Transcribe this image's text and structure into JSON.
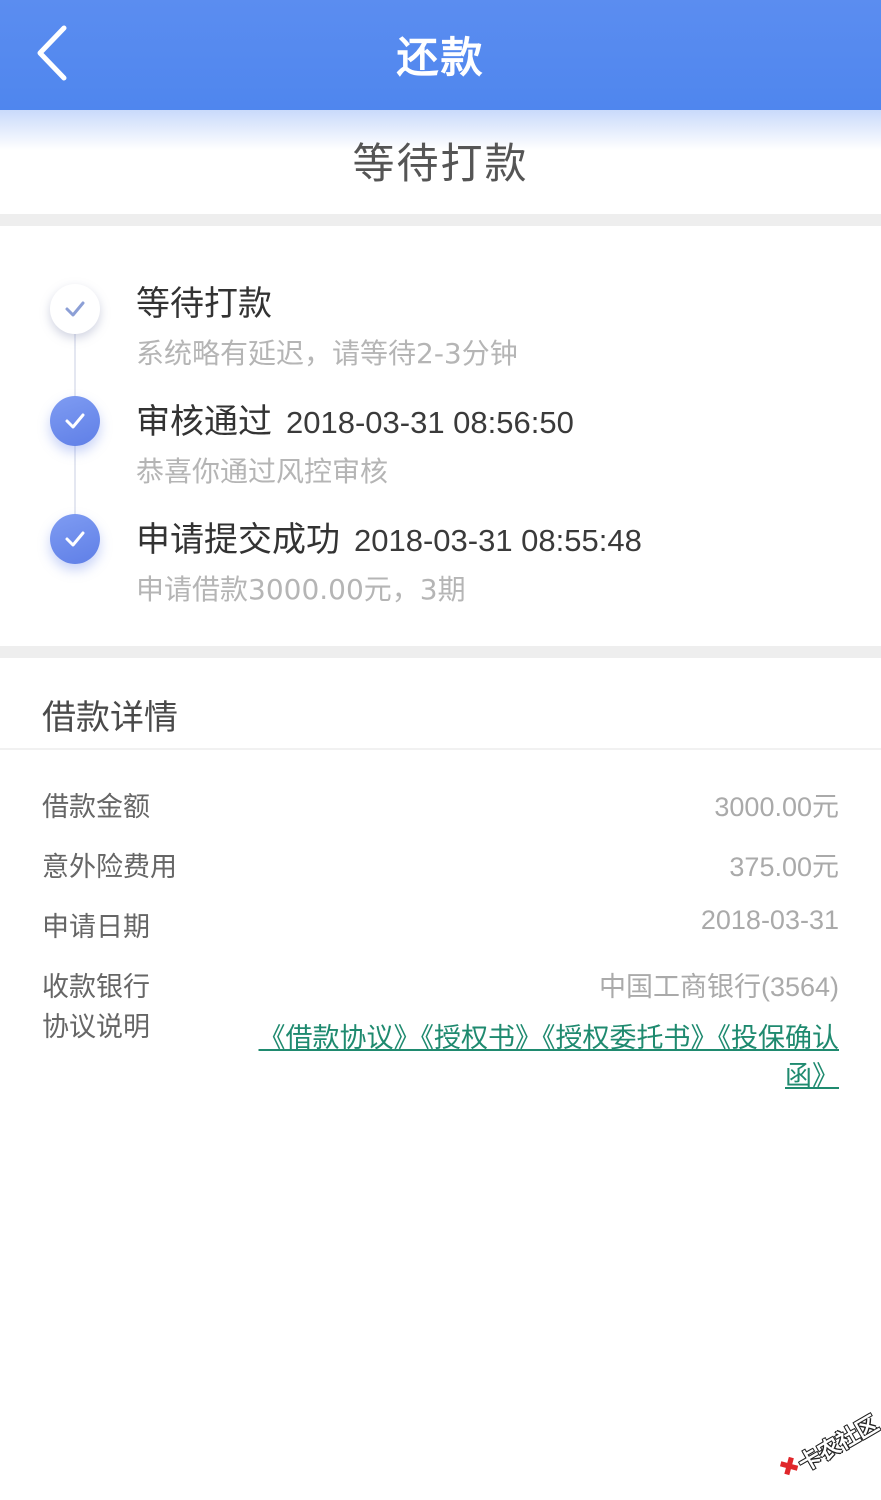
{
  "nav": {
    "title": "还款",
    "back_icon": "chevron-left-icon"
  },
  "status": {
    "heading": "等待打款"
  },
  "timeline": [
    {
      "title": "等待打款",
      "time": "",
      "desc": "系统略有延迟，请等待2-3分钟",
      "state": "pending"
    },
    {
      "title": "审核通过",
      "time": "2018-03-31 08:56:50",
      "desc": "恭喜你通过风控审核",
      "state": "done"
    },
    {
      "title": "申请提交成功",
      "time": "2018-03-31 08:55:48",
      "desc": "申请借款3000.00元，3期",
      "state": "done"
    }
  ],
  "details": {
    "title": "借款详情",
    "rows": [
      {
        "label": "借款金额",
        "value": "3000.00元"
      },
      {
        "label": "意外险费用",
        "value": "375.00元"
      },
      {
        "label": "申请日期",
        "value": "2018-03-31"
      },
      {
        "label": "收款银行",
        "value": "中国工商银行(3564)"
      },
      {
        "label": "协议说明",
        "value": ""
      }
    ],
    "agreements": [
      "《借款协议》",
      "《授权书》",
      "《授权委托书》",
      "《投保确认函》"
    ]
  },
  "watermark": {
    "text": "卡农社区"
  },
  "colors": {
    "nav_bg": "#4f86ee",
    "timeline_done": "#6a88ec",
    "link": "#1f8a6f",
    "watermark_mark": "#e0262a"
  }
}
